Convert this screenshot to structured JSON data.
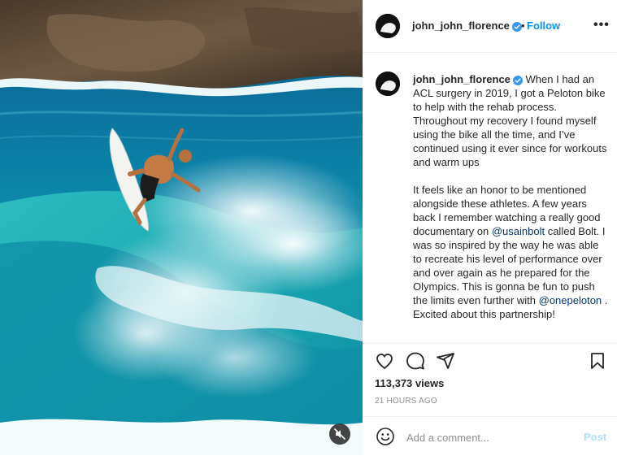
{
  "header": {
    "username": "john_john_florence",
    "separator": "•",
    "follow_label": "Follow",
    "more_label": "•••"
  },
  "caption": {
    "username": "john_john_florence",
    "para1": "When I had an ACL surgery in 2019, I got a Peloton bike to help with the rehab process. Throughout my recovery I found myself using the bike all the time, and I’ve continued using it ever since for workouts and warm ups",
    "para2_before": "It feels like an honor to be mentioned alongside these athletes. A few years back I remember watching a really good documentary on ",
    "mention1": "@usainbolt",
    "para2_middle": " called Bolt. I was so inspired by the way he was able to recreate his level of performance over and over again as he prepared for the Olympics. This is gonna be fun to push the limits even further with ",
    "mention2": "@onepeloton",
    "para2_after": " . Excited about this partnership!"
  },
  "stats": {
    "views": "113,373 views",
    "time": "21 HOURS AGO"
  },
  "comment": {
    "placeholder": "Add a comment...",
    "post_label": "Post"
  },
  "icons": {
    "verified": "verified-badge-icon",
    "like": "heart-icon",
    "comment": "comment-icon",
    "share": "share-icon",
    "save": "bookmark-icon",
    "emoji": "emoji-icon",
    "mute": "audio-muted-icon"
  },
  "colors": {
    "accent": "#0095f6",
    "mention": "#00376b",
    "post_disabled": "#b2dffc",
    "muted_text": "#8e8e8e"
  }
}
